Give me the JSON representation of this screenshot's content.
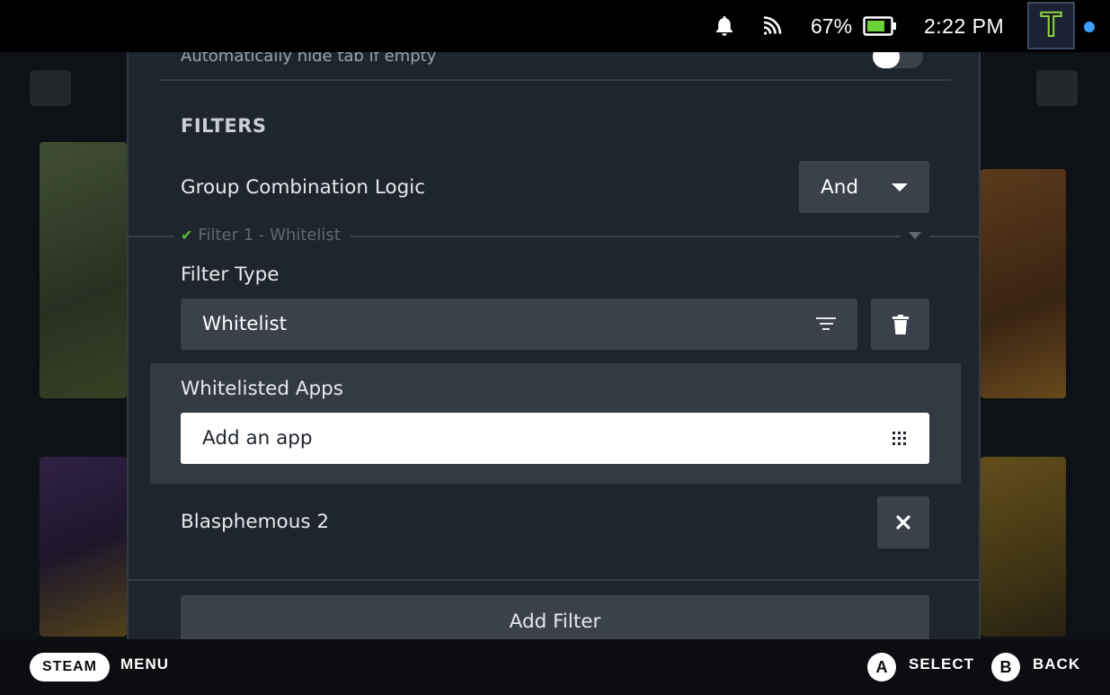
{
  "status_bar": {
    "battery_percent": "67%",
    "time": "2:22 PM",
    "avatar_letter": "T",
    "icons": [
      "bell-icon",
      "wifi-icon",
      "battery-icon"
    ]
  },
  "panel": {
    "toggle_row": {
      "label": "Automatically hide tab if empty",
      "enabled": false
    },
    "filters_title": "FILTERS",
    "group_logic": {
      "label": "Group Combination Logic",
      "value": "And"
    },
    "filter1": {
      "legend": "Filter 1 - Whitelist",
      "type_label": "Filter Type",
      "type_value": "Whitelist",
      "apps_label": "Whitelisted Apps",
      "add_app_placeholder": "Add an app",
      "apps": [
        "Blasphemous 2"
      ]
    },
    "add_filter_label": "Add Filter"
  },
  "bottom_bar": {
    "steam_label": "STEAM",
    "menu_label": "MENU",
    "a_glyph": "A",
    "select_label": "SELECT",
    "b_glyph": "B",
    "back_label": "BACK"
  }
}
